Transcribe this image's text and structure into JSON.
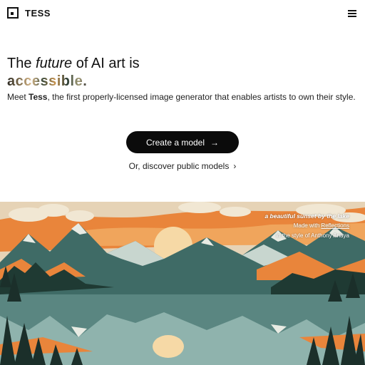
{
  "brand": {
    "name": "TESS"
  },
  "hero": {
    "line1_pre": "The ",
    "line1_em": "future",
    "line1_post": " of AI art is",
    "line2": "accessible.",
    "desc_pre": "Meet ",
    "desc_bold": "Tess",
    "desc_post": ", the first properly-licensed image generator that enables artists to own their style."
  },
  "cta": {
    "label": "Create a model",
    "arrow": "→"
  },
  "discover": {
    "label": "Or, discover public models",
    "chevron": "›"
  },
  "caption": {
    "title": "a beautiful sunset by the lake",
    "made_pre": "Made with ",
    "made_link": "Reflections",
    "style": "in the style of Anthony Anaya"
  },
  "icons": {
    "menu": "hamburger-menu-icon",
    "logo": "tess-logo-icon"
  },
  "colors": {
    "sky": "#e6d3b6",
    "cloud": "#f1e7d3",
    "sun": "#f6d9a6",
    "orange": "#e9853b",
    "mountain": "#3f6b66",
    "snow": "#e8ebe3",
    "forest": "#1f3a33",
    "water": "#8fb3ad"
  }
}
